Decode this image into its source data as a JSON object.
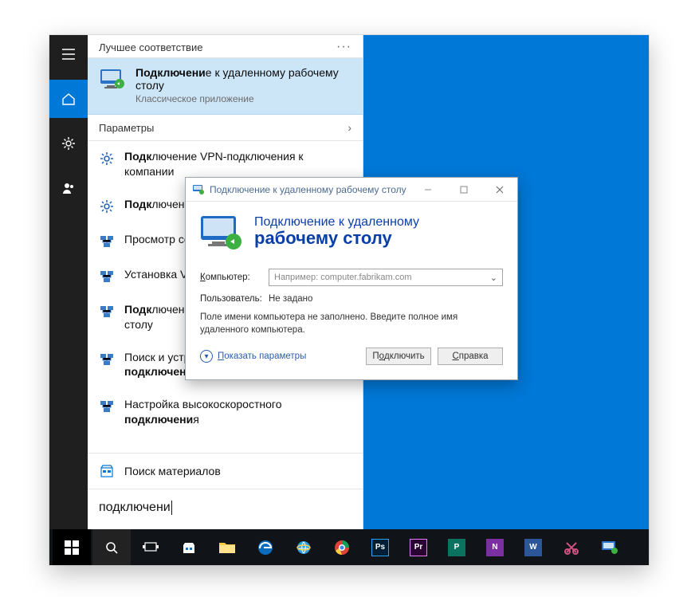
{
  "start": {
    "best_match_header": "Лучшее соответствие",
    "best_match": {
      "title_pre": "Подключени",
      "title_bold_frag": "е",
      "title_post": " к удаленному рабочему столу",
      "subtitle": "Классическое приложение"
    },
    "params_header": "Параметры",
    "results": [
      {
        "pre": "",
        "bold": "Подк",
        "post": "лючение VPN-подключения к компании"
      },
      {
        "pre": "",
        "bold": "Подк",
        "post": "лючение компьютера к домену"
      },
      {
        "pre": "Просмотр сетевых ",
        "bold": "подк",
        "post": "лючений"
      },
      {
        "pre": "Установка VPN-",
        "bold": "подк",
        "post": "лючения"
      },
      {
        "pre": "",
        "bold": "Подк",
        "post": "лючение к удаленному рабочему столу"
      },
      {
        "pre": "Поиск и устранение проблем с сетью и ",
        "bold": "подключени",
        "post": "ем"
      },
      {
        "pre": "Настройка высокоскоростного ",
        "bold": "подключени",
        "post": "я"
      }
    ],
    "store_row": "Поиск материалов",
    "search_value": "подключени"
  },
  "rdp": {
    "title": "Подключение к удаленному рабочему столу",
    "banner_line1": "Подключение к удаленному",
    "banner_line2": "рабочему столу",
    "label_computer": "Компьютер:",
    "placeholder": "Например: computer.fabrikam.com",
    "label_user": "Пользователь:",
    "user_value": "Не задано",
    "hint": "Поле имени компьютера не заполнено. Введите полное имя удаленного компьютера.",
    "show_options": "Показать параметры",
    "connect_pre": "П",
    "connect_u": "о",
    "connect_post": "дключить",
    "help_pre": "",
    "help_u": "С",
    "help_post": "правка"
  },
  "taskbar": {
    "items": [
      "start",
      "search",
      "taskview",
      "store",
      "explorer",
      "edge",
      "ie",
      "chrome",
      "ps",
      "pr",
      "pub",
      "onenote",
      "word",
      "snip",
      "rdp"
    ]
  }
}
